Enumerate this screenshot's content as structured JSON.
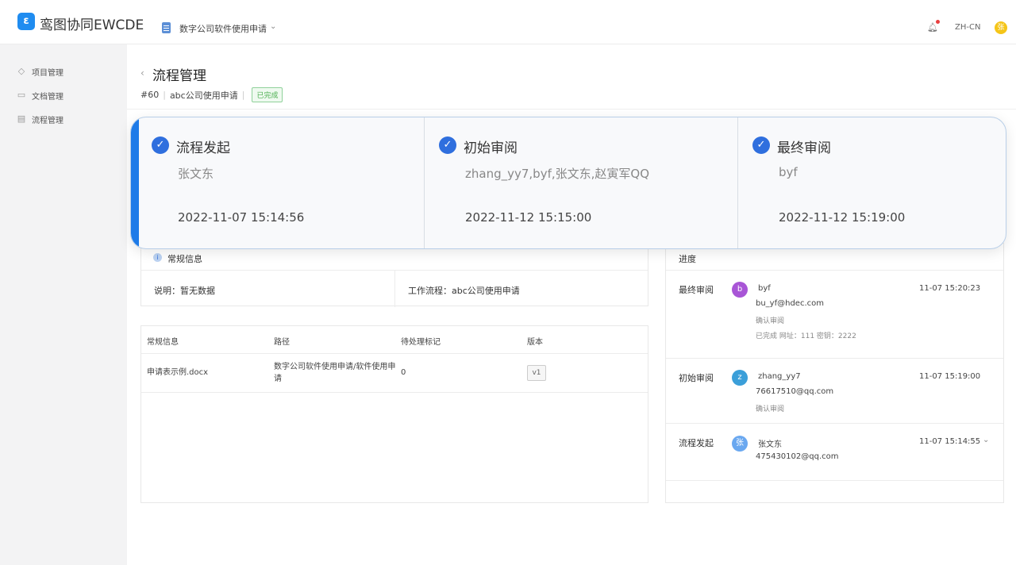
{
  "header": {
    "logo_glyph": "ε",
    "app_title": "鸾图协同EWCDE",
    "project_name": "数字公司软件使用申请",
    "lang": "ZH-CN",
    "avatar_text": "张"
  },
  "sidebar": {
    "items": [
      {
        "label": "项目管理",
        "icon": "layers-icon"
      },
      {
        "label": "文档管理",
        "icon": "folder-icon"
      },
      {
        "label": "流程管理",
        "icon": "process-icon"
      }
    ]
  },
  "page": {
    "back": "‹",
    "title": "流程管理",
    "id": "#60",
    "request_name": "abc公司使用申请",
    "status": "已完成"
  },
  "steps": [
    {
      "check": "✓",
      "title": "流程发起",
      "people": "张文东",
      "time": "2022-11-07 15:14:56"
    },
    {
      "check": "✓",
      "title": "初始审阅",
      "people": "zhang_yy7,byf,张文东,赵寅军QQ",
      "time": "2022-11-12 15:15:00"
    },
    {
      "check": "✓",
      "title": "最终审阅",
      "people": "byf",
      "time": "2022-11-12 15:19:00"
    }
  ],
  "general_info": {
    "icon": "i",
    "title": "常规信息",
    "description": "说明：暂无数据",
    "workflow": "工作流程：abc公司使用申请"
  },
  "file_table": {
    "headers": [
      "常规信息",
      "路径",
      "待处理标记",
      "版本"
    ],
    "rows": [
      {
        "name": "申请表示例.docx",
        "path_line1": "数字公司软件使用申请/软件使用申",
        "path_line2": "请",
        "pending": "0",
        "version": "v1"
      }
    ]
  },
  "progress": {
    "title": "进度",
    "entries": [
      {
        "step": "最终审阅",
        "avatar": "b",
        "name": "byf",
        "email": "bu_yf@hdec.com",
        "note1": "确认审阅",
        "note2": "已完成 网址：111 密钥：2222",
        "time": "11-07 15:20:23"
      },
      {
        "step": "初始审阅",
        "avatar": "z",
        "name": "zhang_yy7",
        "email": "76617510@qq.com",
        "note1": "确认审阅",
        "time": "11-07 15:19:00"
      },
      {
        "step": "流程发起",
        "avatar": "张",
        "name": "张文东",
        "email": "475430102@qq.com",
        "time": "11-07 15:14:55",
        "caret": "⌄"
      }
    ]
  },
  "colors": {
    "accent": "#1e7be8",
    "check": "#2f6fde",
    "status_green": "#4caf50",
    "avatar_purple": "#a855d6",
    "avatar_teal": "#3b9fd9",
    "avatar_blue": "#6aa8f0"
  }
}
